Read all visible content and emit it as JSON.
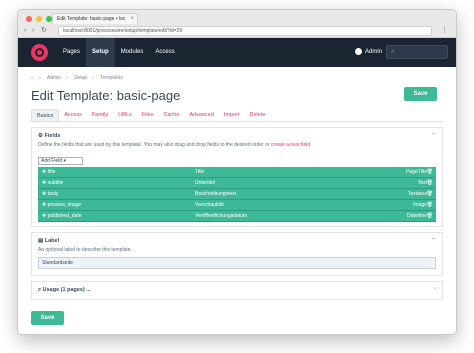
{
  "browser": {
    "tab_title": "Edit Template: basic-page • loc",
    "url": "localhost:8001/processwire/setup/template/edit?id=29",
    "traffic_colors": [
      "#fc605c",
      "#fdbc40",
      "#34c84a"
    ]
  },
  "topbar": {
    "nav": [
      "Pages",
      "Setup",
      "Modules",
      "Access"
    ],
    "active": "Setup",
    "user": "Admin"
  },
  "breadcrumb": [
    "Admin",
    "Setup",
    "Templates"
  ],
  "page": {
    "title": "Edit Template: basic-page",
    "save_label": "Save"
  },
  "tabs": [
    "Basics",
    "Access",
    "Family",
    "URLs",
    "Files",
    "Cache",
    "Advanced",
    "Import",
    "Delete"
  ],
  "fields_panel": {
    "heading": "Fields",
    "description": "Define the fields that are used by this template. You may also drag and drop fields to the desired order or",
    "link_text": "create a new field",
    "add_field": "Add Field",
    "rows": [
      {
        "name": "title",
        "label": "Title",
        "type": "PageTitle"
      },
      {
        "name": "subtitle",
        "label": "Untertitel",
        "type": "Text"
      },
      {
        "name": "body",
        "label": "Beschreibungstext",
        "type": "Textarea"
      },
      {
        "name": "preview_image",
        "label": "Vorschaubild",
        "type": "Image"
      },
      {
        "name": "published_date",
        "label": "Veröffentlichungsdatum",
        "type": "Datetime"
      }
    ]
  },
  "label_panel": {
    "heading": "Label",
    "description": "An optional label to describe this template.",
    "value": "Standardseite"
  },
  "usage_panel": {
    "heading": "Usage (1 pages) ..."
  },
  "colors": {
    "accent": "#3eb998",
    "link": "#e83561",
    "topbar": "#1b2532"
  }
}
